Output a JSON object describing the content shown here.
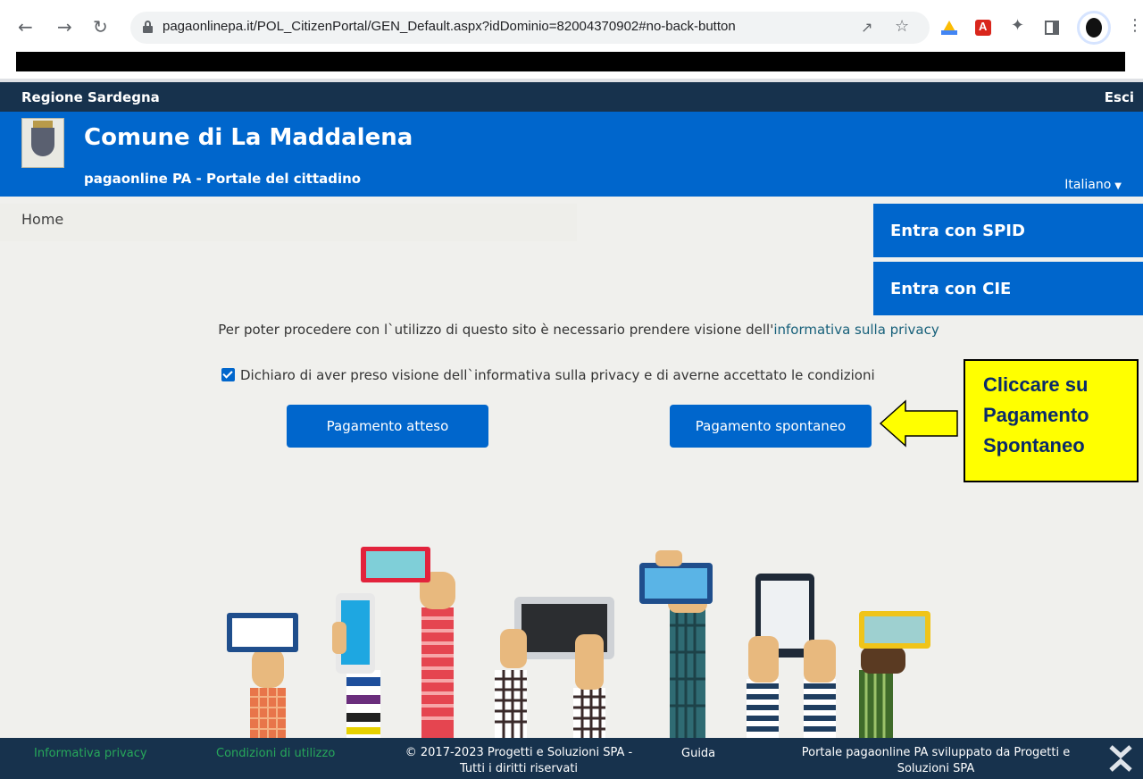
{
  "browser": {
    "url": "pagaonlinepa.it/POL_CitizenPortal/GEN_Default.aspx?idDominio=82004370902#no-back-button"
  },
  "region": {
    "name": "Regione Sardegna",
    "logout_label": "Esci"
  },
  "header": {
    "title": "Comune di La Maddalena",
    "subtitle": "pagaonline PA - Portale del cittadino",
    "language": "Italiano"
  },
  "breadcrumb": {
    "home": "Home"
  },
  "login": {
    "spid_label": "Entra con SPID",
    "cie_label": "Entra con CIE"
  },
  "privacy": {
    "notice_text": "Per poter procedere con l`utilizzo di questo sito è necessario prendere visione dell'",
    "notice_link": "informativa sulla privacy",
    "consent_label": "Dichiaro di aver preso visione dell`informativa sulla privacy e di averne accettato le condizioni",
    "consent_checked": true
  },
  "payment": {
    "expected_label": "Pagamento atteso",
    "spontaneous_label": "Pagamento spontaneo"
  },
  "annotation": {
    "line1": "Cliccare su",
    "line2": "Pagamento",
    "line3": "Spontaneo"
  },
  "footer": {
    "privacy_link": "Informativa privacy",
    "terms_link": "Condizioni di utilizzo",
    "copyright_line1": "© 2017-2023 Progetti e Soluzioni SPA -",
    "copyright_line2": "Tutti i diritti riservati",
    "guide_link": "Guida",
    "developer_line1": "Portale pagaonline PA sviluppato da Progetti e",
    "developer_line2": "Soluzioni SPA"
  },
  "colors": {
    "primary": "#0066cc",
    "dark_bar": "#17324d",
    "footer_link": "#27a85a",
    "callout_bg": "#ffff00"
  }
}
